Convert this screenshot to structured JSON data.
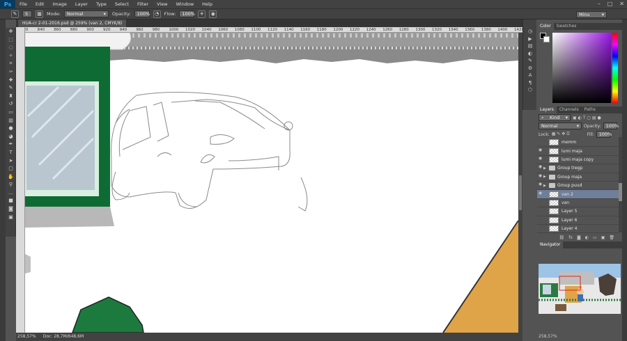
{
  "app": {
    "logo": "Ps"
  },
  "menu": [
    "File",
    "Edit",
    "Image",
    "Layer",
    "Type",
    "Select",
    "Filter",
    "View",
    "Window",
    "Help"
  ],
  "window_controls": {
    "minimize": "–",
    "maximize": "□",
    "close": "✕"
  },
  "options": {
    "brush_size": "5",
    "mode_label": "Mode:",
    "mode_value": "Normal",
    "opacity_label": "Opacity:",
    "opacity_value": "100%",
    "flow_label": "Flow:",
    "flow_value": "100%",
    "workspace": "Minu"
  },
  "document": {
    "tab_title": "HUA-cr 2-01-2016.psd @ 259% (van 2, CMYK/8)",
    "ruler_ticks": [
      "820",
      "840",
      "860",
      "880",
      "900",
      "920",
      "940",
      "960",
      "980",
      "1000",
      "1020",
      "1040",
      "1060",
      "1080",
      "1100",
      "1120",
      "1140",
      "1160",
      "1180",
      "1200",
      "1220",
      "1240",
      "1260",
      "1280",
      "1300",
      "1320",
      "1340",
      "1360",
      "1380",
      "1400",
      "1420",
      "1440",
      "1460"
    ],
    "zoom": "258,57%",
    "doc_info": "Doc: 28,7M/648,6M"
  },
  "tools": [
    "move-icon",
    "marquee-icon",
    "lasso-icon",
    "quick-select-icon",
    "crop-icon",
    "eyedropper-icon",
    "healing-icon",
    "brush-icon",
    "stamp-icon",
    "history-brush-icon",
    "eraser-icon",
    "gradient-icon",
    "blur-icon",
    "dodge-icon",
    "pen-icon",
    "type-icon",
    "path-select-icon",
    "shape-icon",
    "hand-icon",
    "zoom-icon",
    "edit-toolbar-icon",
    "color-swatch-icon",
    "quickmask-icon",
    "screenmode-icon"
  ],
  "color_panel": {
    "tabs": [
      "Color",
      "Swatches"
    ],
    "fg": "#000000",
    "bg": "#ffffff"
  },
  "layers_panel": {
    "tabs": [
      "Layers",
      "Channels",
      "Paths"
    ],
    "filter_label": "Kind",
    "blend_mode": "Normal",
    "opacity_label": "Opacity:",
    "opacity_value": "100%",
    "lock_label": "Lock:",
    "fill_label": "Fill:",
    "fill_value": "100%",
    "layers": [
      {
        "name": "memm",
        "visible": false,
        "type": "layer",
        "selected": false
      },
      {
        "name": "lumi maja",
        "visible": true,
        "type": "layer",
        "selected": false
      },
      {
        "name": "lumi maja copy",
        "visible": true,
        "type": "layer",
        "selected": false
      },
      {
        "name": "Group tregp",
        "visible": true,
        "type": "group",
        "selected": false
      },
      {
        "name": "Group maja",
        "visible": true,
        "type": "group",
        "selected": false
      },
      {
        "name": "Group puud",
        "visible": true,
        "type": "group",
        "selected": false
      },
      {
        "name": "van 2",
        "visible": true,
        "type": "layer",
        "selected": true
      },
      {
        "name": "van",
        "visible": false,
        "type": "layer",
        "selected": false
      },
      {
        "name": "Layer 5",
        "visible": false,
        "type": "layer",
        "selected": false
      },
      {
        "name": "Layer 6",
        "visible": false,
        "type": "layer",
        "selected": false
      },
      {
        "name": "Layer 4",
        "visible": false,
        "type": "layer",
        "selected": false
      }
    ]
  },
  "navigator": {
    "title": "Navigator",
    "zoom": "258,57%"
  }
}
